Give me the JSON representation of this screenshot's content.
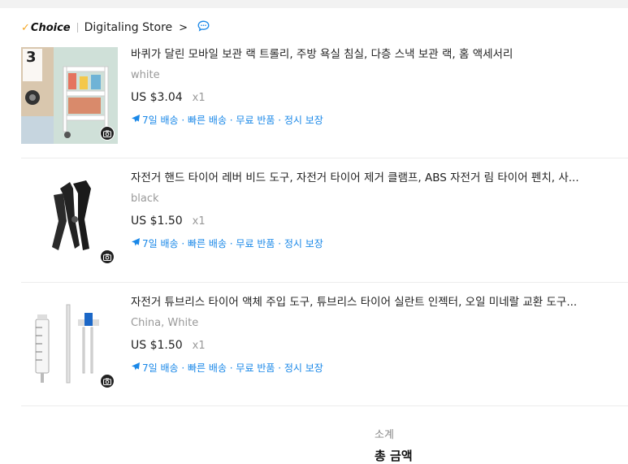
{
  "store": {
    "choice_label": "Choice",
    "name": "Digitaling Store",
    "chevron": ">"
  },
  "items": [
    {
      "title": "바퀴가 달린 모바일 보관 랙 트롤리, 주방 욕실 침실, 다층 스낵 보관 랙, 홈 액세서리",
      "variant": "white",
      "price": "US $3.04",
      "qty": "x1",
      "shipping": "7일 배송 · 빠른 배송 · 무료 반품 · 정시 보장",
      "thumb_badge": "3"
    },
    {
      "title": "자전거 핸드 타이어 레버 비드 도구, 자전거 타이어 제거 클램프, ABS 자전거 림 타이어 펜치, 사...",
      "variant": "black",
      "price": "US $1.50",
      "qty": "x1",
      "shipping": "7일 배송 · 빠른 배송 · 무료 반품 · 정시 보장"
    },
    {
      "title": "자전거 튜브리스 타이어 액체 주입 도구, 튜브리스 타이어 실란트 인젝터, 오일 미네랄 교환 도구...",
      "variant": "China, White",
      "price": "US $1.50",
      "qty": "x1",
      "shipping": "7일 배송 · 빠른 배송 · 무료 반품 · 정시 보장"
    }
  ],
  "summary": {
    "subtotal_label": "소계",
    "total_label": "총 금액"
  },
  "colors": {
    "accent_blue": "#1a88e8",
    "choice_check": "#f5a623"
  }
}
